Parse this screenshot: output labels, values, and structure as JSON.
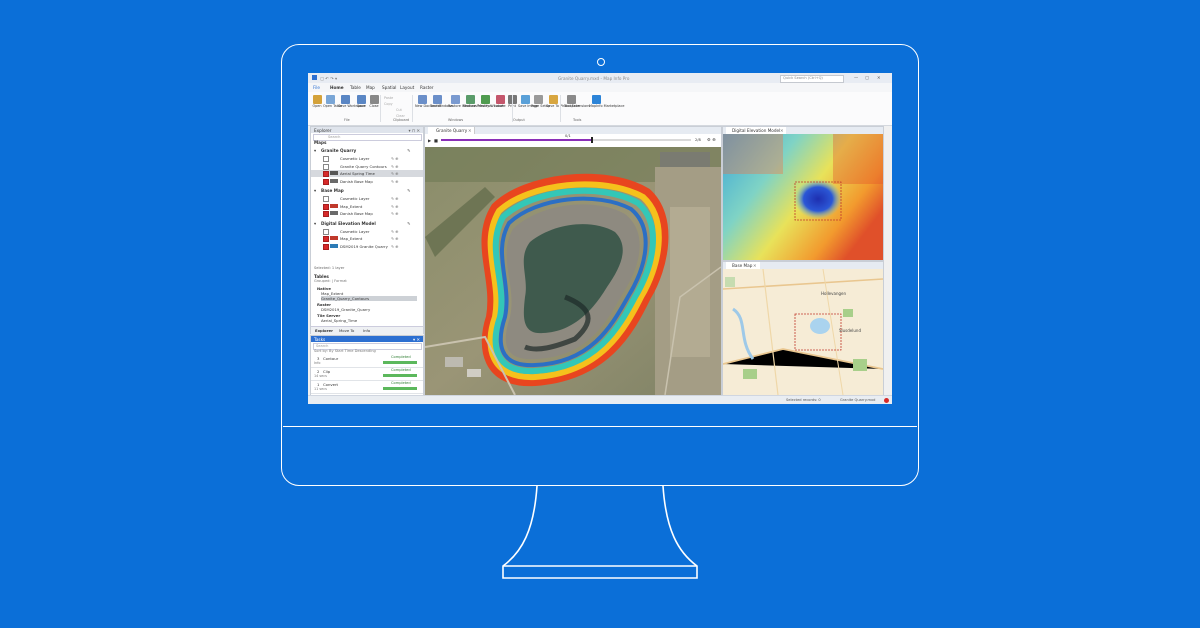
{
  "window": {
    "title": "Granite Quarry.mxd - Map Info Pro",
    "search_placeholder": "Quick Search (Ctrl+Q)"
  },
  "menu": [
    "File",
    "Home",
    "Table",
    "Map",
    "Spatial",
    "Layout",
    "Raster"
  ],
  "ribbon": {
    "buttons": [
      {
        "label": "Open",
        "icon": "open-icon",
        "color": "#d4a23a"
      },
      {
        "label": "Open Table",
        "icon": "table-icon",
        "color": "#7aa6d6"
      },
      {
        "label": "Save Workspace",
        "icon": "save-icon",
        "color": "#5a86c4"
      },
      {
        "label": "Save",
        "icon": "save-icon",
        "color": "#5a86c4"
      },
      {
        "label": "Close",
        "icon": "close-icon",
        "color": "#888888"
      },
      {
        "label": "New Document",
        "icon": "document-icon",
        "color": "#6b8fc9"
      },
      {
        "label": "Tool Windows",
        "icon": "window-icon",
        "color": "#6b8fc9"
      },
      {
        "label": "Restore Windows",
        "icon": "restore-icon",
        "color": "#7a9ad0"
      },
      {
        "label": "Feature Previews",
        "icon": "preview-icon",
        "color": "#5a9c6a"
      },
      {
        "label": "Modify Window",
        "icon": "modify-icon",
        "color": "#4f9b4f"
      },
      {
        "label": "Locate",
        "icon": "locate-icon",
        "color": "#c4566c"
      },
      {
        "label": "Print",
        "icon": "print-icon",
        "color": "#777777"
      },
      {
        "label": "Save Image",
        "icon": "image-icon",
        "color": "#5aa0d8"
      },
      {
        "label": "Page Setup",
        "icon": "page-icon",
        "color": "#9a9a9a"
      },
      {
        "label": "Save To Photospace",
        "icon": "photo-icon",
        "color": "#d8a640"
      },
      {
        "label": "Tool Extensions",
        "icon": "extension-icon",
        "color": "#8a8a8a"
      },
      {
        "label": "MapInfo Marketplace",
        "icon": "marketplace-icon",
        "color": "#2c84d8"
      }
    ],
    "groups": [
      "File",
      "Clipboard",
      "Windows",
      "Output",
      "Tools"
    ],
    "clipboard": [
      "Paste",
      "Copy",
      "Cut",
      "Clear"
    ]
  },
  "explorer": {
    "title": "Explorer",
    "search_placeholder": "Search",
    "maps_label": "Maps",
    "groups": [
      {
        "name": "Granite Quarry",
        "layers": [
          {
            "name": "Cosmetic Layer",
            "checked": false,
            "swatch": ""
          },
          {
            "name": "Granite Quarry Contours",
            "checked": false,
            "swatch": ""
          },
          {
            "name": "Aerial Spring Time",
            "checked": true,
            "swatch": "#555555"
          },
          {
            "name": "Danish Base Map",
            "checked": true,
            "swatch": "#6a6a6a"
          }
        ]
      },
      {
        "name": "Base Map",
        "layers": [
          {
            "name": "Cosmetic Layer",
            "checked": false,
            "swatch": ""
          },
          {
            "name": "Map_Extent",
            "checked": true,
            "swatch": "#c0392b"
          },
          {
            "name": "Danish Base Map",
            "checked": true,
            "swatch": "#6a6a6a"
          }
        ]
      },
      {
        "name": "Digital Elevation Model",
        "layers": [
          {
            "name": "Cosmetic Layer",
            "checked": false,
            "swatch": ""
          },
          {
            "name": "Map_Extent",
            "checked": true,
            "swatch": "#c0392b"
          },
          {
            "name": "DSM2019 Granite Quarry",
            "checked": true,
            "swatch": "#2c7bb6"
          }
        ]
      }
    ],
    "selected_layer": "Selected: 1 layer",
    "tables_label": "Tables",
    "grouped_by": "Grouped: | Format",
    "table_groups": [
      {
        "name": "Native",
        "items": [
          "Map_Extent",
          "Granite_Quarry_Contours"
        ]
      },
      {
        "name": "Raster",
        "items": [
          "DSM2019_Granite_Quarry"
        ]
      },
      {
        "name": "Tile Server",
        "items": [
          "Aerial_Spring_Time"
        ]
      }
    ],
    "tabs": [
      "Explorer",
      "Move To",
      "Info"
    ]
  },
  "tasks": {
    "title": "Tasks",
    "search_placeholder": "Search",
    "sort_label": "Sort by: By Start Time Descending",
    "items": [
      {
        "index": "3",
        "name": "Contour",
        "sub": "Info",
        "status": "Completed",
        "progress": 1.0
      },
      {
        "index": "2",
        "name": "Clip",
        "sub": "14 secs",
        "status": "Completed",
        "progress": 1.0
      },
      {
        "index": "1",
        "name": "Convert",
        "sub": "11 secs",
        "status": "Completed",
        "progress": 1.0
      }
    ]
  },
  "map_main": {
    "tab": "Granite Quarry",
    "slider_value": "0/1",
    "slider_end": "2/8",
    "progress": 0.6
  },
  "map_dem": {
    "tab": "Digital Elevation Model"
  },
  "map_base": {
    "tab": "Base Map",
    "labels": [
      "Hollevangen",
      "Slusdelund"
    ]
  },
  "status": {
    "selected": "Selected records: 0",
    "current": "Granite Quarry.mxd"
  }
}
